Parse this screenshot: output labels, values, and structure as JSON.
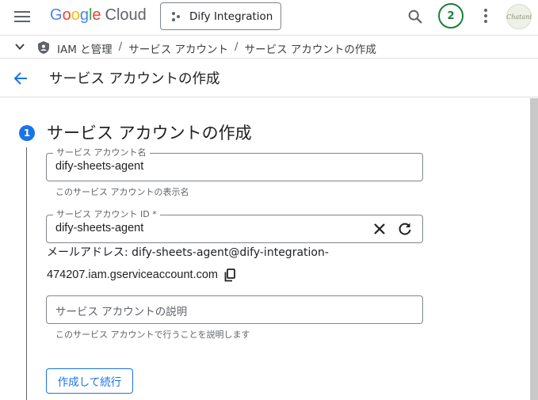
{
  "header": {
    "logo_google": [
      "G",
      "o",
      "o",
      "g",
      "l",
      "e"
    ],
    "logo_cloud": "Cloud",
    "project_name": "Dify Integration",
    "notification_count": "2",
    "avatar_text": "Chatani"
  },
  "breadcrumb": {
    "items": [
      "IAM と管理",
      "サービス アカウント",
      "サービス アカウントの作成"
    ],
    "separator": "/"
  },
  "page": {
    "title": "サービス アカウントの作成"
  },
  "step": {
    "number": "1",
    "title": "サービス アカウントの作成"
  },
  "form": {
    "name_field": {
      "label": "サービス アカウント名",
      "value": "dify-sheets-agent",
      "hint": "このサービス アカウントの表示名"
    },
    "id_field": {
      "label": "サービス アカウント ID *",
      "value": "dify-sheets-agent"
    },
    "email": {
      "line1": "メールアドレス: dify-sheets-agent@dify-integration-",
      "line2": "474207.iam.gserviceaccount.com"
    },
    "description_field": {
      "placeholder": "サービス アカウントの説明",
      "hint": "このサービス アカウントで行うことを説明します"
    },
    "submit_label": "作成して続行"
  },
  "colors": {
    "accent": "#1a73e8",
    "badge": "#188038",
    "text": "#202124",
    "muted": "#5f6368"
  },
  "icons": [
    "hamburger-icon",
    "project-icon",
    "search-icon",
    "more-vert-icon",
    "chevron-down-icon",
    "shield-icon",
    "back-arrow-icon",
    "clear-icon",
    "refresh-icon",
    "copy-icon"
  ]
}
